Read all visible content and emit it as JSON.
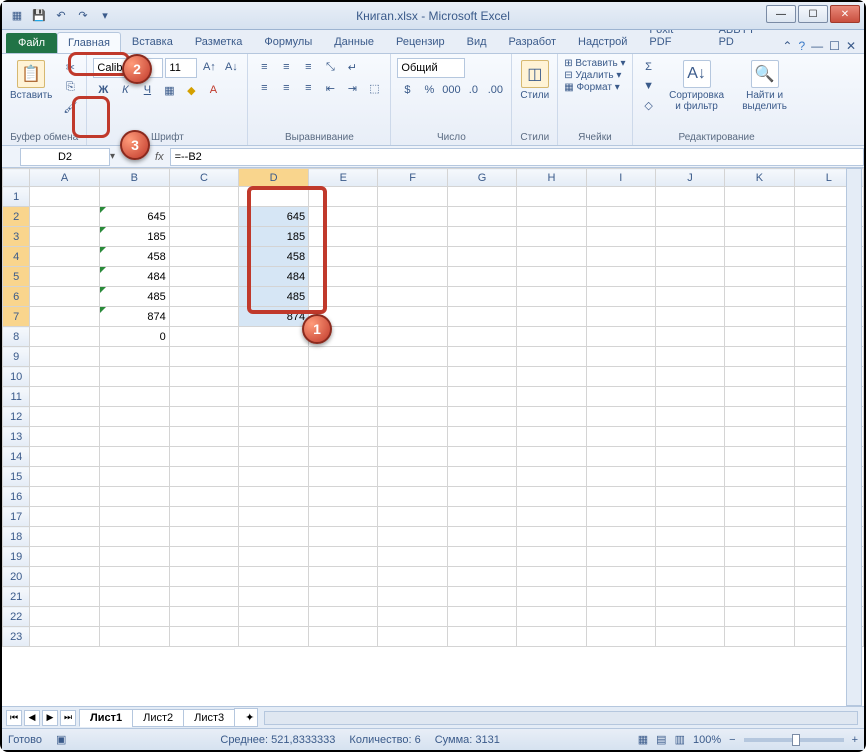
{
  "title": "Книгаn.xlsx - Microsoft Excel",
  "tabs": {
    "file": "Файл",
    "items": [
      "Главная",
      "Вставка",
      "Разметка",
      "Формулы",
      "Данные",
      "Рецензир",
      "Вид",
      "Разработ",
      "Надстрой",
      "Foxit PDF",
      "ABBYY PD"
    ]
  },
  "ribbon": {
    "clipboard": {
      "paste": "Вставить",
      "label": "Буфер обмена"
    },
    "font": {
      "name": "Calibri",
      "size": "11",
      "label": "Шрифт"
    },
    "align": {
      "label": "Выравнивание"
    },
    "number": {
      "format": "Общий",
      "label": "Число"
    },
    "styles": {
      "btn": "Стили",
      "label": "Стили"
    },
    "cells": {
      "insert": "Вставить",
      "delete": "Удалить",
      "format": "Формат",
      "label": "Ячейки"
    },
    "editing": {
      "sort": "Сортировка и фильтр",
      "find": "Найти и выделить",
      "label": "Редактирование"
    }
  },
  "namebox": "D2",
  "formula": "=--B2",
  "columns": [
    "A",
    "B",
    "C",
    "D",
    "E",
    "F",
    "G",
    "H",
    "I",
    "J",
    "K",
    "L"
  ],
  "rows": 23,
  "data_b": [
    "645",
    "185",
    "458",
    "484",
    "485",
    "874"
  ],
  "data_b8": "0",
  "data_d": [
    "645",
    "185",
    "458",
    "484",
    "485",
    "874"
  ],
  "sheets": [
    "Лист1",
    "Лист2",
    "Лист3"
  ],
  "status": {
    "ready": "Готово",
    "avg_label": "Среднее:",
    "avg": "521,8333333",
    "count_label": "Количество:",
    "count": "6",
    "sum_label": "Сумма:",
    "sum": "3131",
    "zoom": "100%"
  },
  "callouts": {
    "c1": "1",
    "c2": "2",
    "c3": "3"
  }
}
